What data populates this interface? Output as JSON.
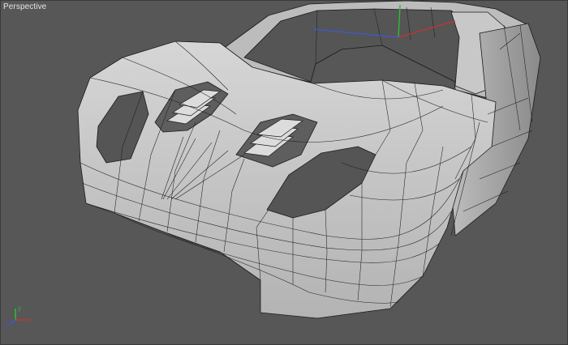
{
  "viewport": {
    "label": "Perspective",
    "background": "#575757"
  },
  "scene": {
    "object": "car-body-wireframe-mesh",
    "mesh_fill": "#c9c9c9",
    "wire_color": "#1a1a1a"
  },
  "gizmo": {
    "x_label": "x",
    "y_label": "y",
    "z_label": "z",
    "x_color": "#c83232",
    "y_color": "#2bbd3a",
    "z_color": "#3c5ad6"
  }
}
